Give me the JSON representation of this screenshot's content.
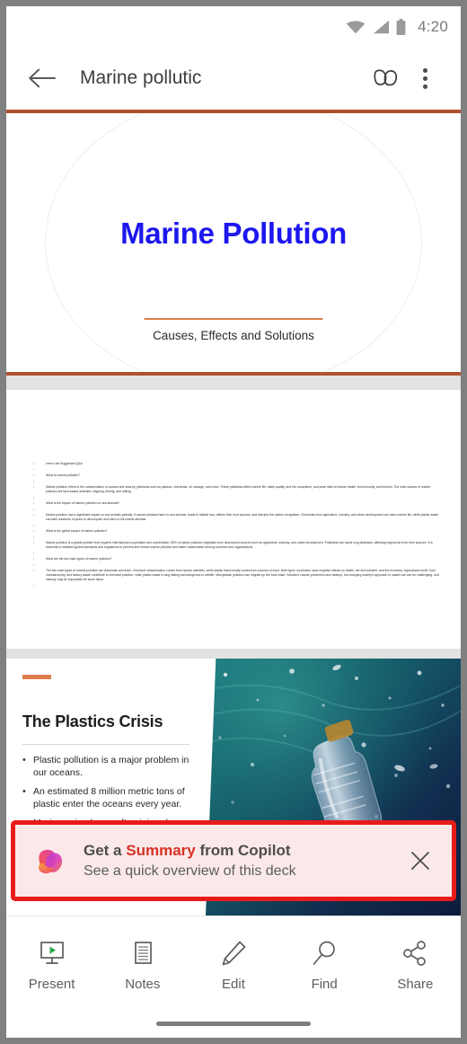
{
  "status_bar": {
    "time": "4:20",
    "icons": [
      "wifi-icon",
      "cell-signal-icon",
      "battery-icon"
    ]
  },
  "header": {
    "back_icon": "back-arrow-icon",
    "title": "Marine pollutic",
    "copilot_icon": "copilot-outline-icon",
    "overflow_icon": "more-vertical-icon"
  },
  "deck": {
    "slides": [
      {
        "index": 1,
        "name": "title-slide",
        "title": "Marine Pollution",
        "subtitle": "Causes, Effects and Solutions",
        "title_color": "#1c17ee",
        "rule_color": "#dd7f52",
        "border_color": "#b0522f"
      },
      {
        "index": 2,
        "name": "qa-text-slide",
        "lines": [
          "Here's the Suggested Q&A:",
          "What is marine pollution?",
          "Marine pollution refers to the contamination of oceans and seas by pollutants such as plastics, chemicals, oil, sewage, and noise. These pollutants affect marine life, water quality, and the ecosystem, and pose risks to human health, food security, and tourism. The main causes of marine pollution are land-based activities, shipping, fishing, and drilling.",
          "What is the impact of marine pollution on sea animals?",
          "Marine pollution has a significant impact on sea animals globally. It causes physical harm to sea animals, leads to habitat loss, affects their food sources, and disrupts the marine ecosystem. Chemicals from agriculture, industry, and urban development can harm marine life, while plastic waste can take hundreds of years to decompose and harm or kill marine animals.",
          "What is the global impact of marine pollution?",
          "Marine pollution is a global problem that requires international cooperation and coordination. 80% of marine pollution originates from land-based sources such as agriculture, industry, and urban development. Pollutants can travel long distances, affecting regions far from their sources. It is essential to establish global standards and regulations to prevent and reduce marine pollution and foster collaboration among countries and organizations.",
          "What are the two main types of marine pollution?",
          "The two main types of marine pollution are chemicals and trash. Chemical contamination comes from human activities, while plastic trash mostly comes from sources on land. Both types of pollution have negative effects on health, the environment, and the economy. Agricultural runoff, food manufacturing, and factory waste contribute to chemical pollution, while plastic waste is long lasting and dangerous to wildlife. Microplastic pollution can migrate up the food chain. Solutions include prevention and cleanup, but changing society's approach to plastic use can be challenging, and cleanup may be impossible for some items."
        ]
      },
      {
        "index": 3,
        "name": "plastics-crisis-slide",
        "accent_color": "#e07b4c",
        "title": "The Plastics Crisis",
        "bullets": [
          "Plastic pollution is a major problem in our oceans.",
          "An estimated 8 million metric tons of plastic enter the oceans every year.",
          "Marine animals are often injured or killed by plastic in the ocean."
        ],
        "image_alt": "plastic-bottle-underwater-photo"
      }
    ]
  },
  "copilot_banner": {
    "logo_icon": "copilot-logo-icon",
    "headline_prefix": "Get a ",
    "headline_highlight": "Summary",
    "headline_suffix": " from Copilot",
    "subtext": "See a quick overview of this deck",
    "close_icon": "close-icon",
    "highlight_color": "#d93025",
    "outline_color": "#e81b1b",
    "background_color": "#fbe9ea"
  },
  "toolbar": {
    "items": [
      {
        "label": "Present",
        "icon": "present-screen-icon"
      },
      {
        "label": "Notes",
        "icon": "notes-document-icon"
      },
      {
        "label": "Edit",
        "icon": "pencil-edit-icon"
      },
      {
        "label": "Find",
        "icon": "search-magnifier-icon"
      },
      {
        "label": "Share",
        "icon": "share-nodes-icon"
      }
    ]
  }
}
